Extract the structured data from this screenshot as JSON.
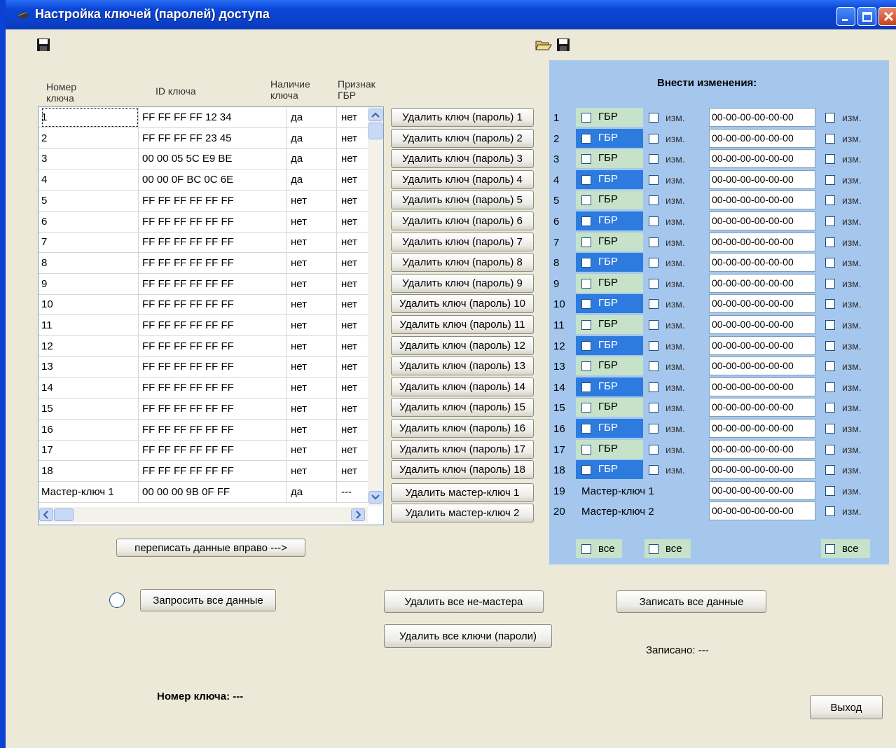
{
  "window": {
    "title": "Настройка ключей (паролей) доступа"
  },
  "grid": {
    "headers": {
      "number": "Номер\nключа",
      "id": "ID ключа",
      "presence": "Наличие\nключа",
      "gbr": "Признак\nГБР"
    },
    "rows": [
      {
        "number": "1",
        "id": "FF FF FF FF 12 34",
        "presence": "да",
        "gbr": "нет"
      },
      {
        "number": "2",
        "id": "FF FF FF FF 23 45",
        "presence": "да",
        "gbr": "нет"
      },
      {
        "number": "3",
        "id": "00 00 05 5C E9 BE",
        "presence": "да",
        "gbr": "нет"
      },
      {
        "number": "4",
        "id": "00 00 0F BC 0C 6E",
        "presence": "да",
        "gbr": "нет"
      },
      {
        "number": "5",
        "id": "FF FF FF FF FF FF",
        "presence": "нет",
        "gbr": "нет"
      },
      {
        "number": "6",
        "id": "FF FF FF FF FF FF",
        "presence": "нет",
        "gbr": "нет"
      },
      {
        "number": "7",
        "id": "FF FF FF FF FF FF",
        "presence": "нет",
        "gbr": "нет"
      },
      {
        "number": "8",
        "id": "FF FF FF FF FF FF",
        "presence": "нет",
        "gbr": "нет"
      },
      {
        "number": "9",
        "id": "FF FF FF FF FF FF",
        "presence": "нет",
        "gbr": "нет"
      },
      {
        "number": "10",
        "id": "FF FF FF FF FF FF",
        "presence": "нет",
        "gbr": "нет"
      },
      {
        "number": "11",
        "id": "FF FF FF FF FF FF",
        "presence": "нет",
        "gbr": "нет"
      },
      {
        "number": "12",
        "id": "FF FF FF FF FF FF",
        "presence": "нет",
        "gbr": "нет"
      },
      {
        "number": "13",
        "id": "FF FF FF FF FF FF",
        "presence": "нет",
        "gbr": "нет"
      },
      {
        "number": "14",
        "id": "FF FF FF FF FF FF",
        "presence": "нет",
        "gbr": "нет"
      },
      {
        "number": "15",
        "id": "FF FF FF FF FF FF",
        "presence": "нет",
        "gbr": "нет"
      },
      {
        "number": "16",
        "id": "FF FF FF FF FF FF",
        "presence": "нет",
        "gbr": "нет"
      },
      {
        "number": "17",
        "id": "FF FF FF FF FF FF",
        "presence": "нет",
        "gbr": "нет"
      },
      {
        "number": "18",
        "id": "FF FF FF FF FF FF",
        "presence": "нет",
        "gbr": "нет"
      },
      {
        "number": "Мастер-ключ 1",
        "id": "00 00 00 9B 0F FF",
        "presence": "да",
        "gbr": "---"
      }
    ]
  },
  "delete_buttons": [
    "Удалить ключ (пароль) 1",
    "Удалить ключ (пароль) 2",
    "Удалить ключ (пароль) 3",
    "Удалить ключ (пароль) 4",
    "Удалить ключ (пароль) 5",
    "Удалить ключ (пароль) 6",
    "Удалить ключ (пароль) 7",
    "Удалить ключ (пароль) 8",
    "Удалить ключ (пароль) 9",
    "Удалить ключ (пароль) 10",
    "Удалить ключ (пароль) 11",
    "Удалить ключ (пароль) 12",
    "Удалить ключ (пароль) 13",
    "Удалить ключ (пароль) 14",
    "Удалить ключ (пароль) 15",
    "Удалить ключ (пароль) 16",
    "Удалить ключ (пароль) 17",
    "Удалить ключ (пароль) 18",
    "Удалить мастер-ключ 1",
    "Удалить мастер-ключ 2"
  ],
  "panel": {
    "title": "Внести изменения:",
    "gbr_label": "ГБР",
    "izm_label": "изм.",
    "all_label": "все",
    "field_value": "00-00-00-00-00-00",
    "numbers": [
      "1",
      "2",
      "3",
      "4",
      "5",
      "6",
      "7",
      "8",
      "9",
      "10",
      "11",
      "12",
      "13",
      "14",
      "15",
      "16",
      "17",
      "18",
      "19",
      "20"
    ],
    "masters": [
      "Мастер-ключ 1",
      "Мастер-ключ 2"
    ],
    "colors": {
      "gbr_light": "#C6E2C9",
      "gbr_blue": "#2E7BE0",
      "panel_bg": "#A5C7EE"
    }
  },
  "buttons": {
    "copy_right": "переписать данные вправо --->",
    "request_all": "Запросить все данные",
    "delete_non_masters": "Удалить все не-мастера",
    "delete_all_keys": "Удалить все ключи (пароли)",
    "write_all": "Записать все данные",
    "exit": "Выход"
  },
  "status": {
    "written": "Записано: ---",
    "key_number": "Номер ключа: ---"
  },
  "icons": {
    "save_left": "save-icon",
    "open": "folder-open-icon",
    "save_right": "save-icon"
  }
}
